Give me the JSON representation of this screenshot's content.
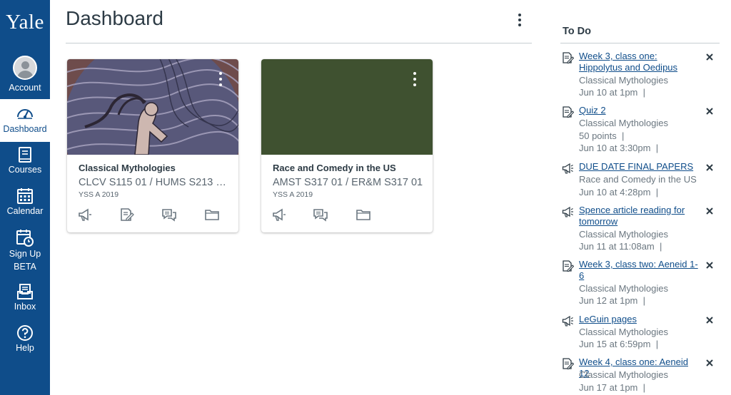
{
  "global_nav": {
    "logo": "Yale",
    "items": [
      {
        "label": "Account",
        "icon": "user-avatar-icon"
      },
      {
        "label": "Dashboard",
        "icon": "dashboard-gauge-icon"
      },
      {
        "label": "Courses",
        "icon": "courses-book-icon"
      },
      {
        "label": "Calendar",
        "icon": "calendar-icon"
      },
      {
        "label": "Sign Up",
        "label2": "BETA",
        "icon": "signup-calendar-clock-icon"
      },
      {
        "label": "Inbox",
        "icon": "inbox-tray-icon"
      },
      {
        "label": "Help",
        "icon": "help-question-icon"
      }
    ],
    "active": "Dashboard",
    "colors": {
      "background": "#0f4d8a",
      "active_background": "#ffffff"
    }
  },
  "dashboard": {
    "title": "Dashboard",
    "cards": [
      {
        "title": "Classical Mythologies",
        "code": "CLCV S115 01 / HUMS S213 01 / ...",
        "term": "YSS A 2019",
        "hero": "image",
        "icons": [
          "announcements-icon",
          "assignments-icon",
          "discussions-icon",
          "files-icon"
        ]
      },
      {
        "title": "Race and Comedy in the US",
        "code": "AMST S317 01 / ER&M S317 01",
        "term": "YSS A 2019",
        "hero": "color",
        "hero_color": "#3f5130",
        "icons": [
          "announcements-icon",
          "discussions-icon",
          "files-icon"
        ]
      }
    ]
  },
  "todo": {
    "title": "To Do",
    "items": [
      {
        "type": "assignment",
        "icon": "assignment-icon",
        "title": "Week 3, class one: Hippolytus and Oedipus",
        "course": "Classical Mythologies",
        "points": "",
        "due": "Jun 10 at 1pm",
        "sep": "|"
      },
      {
        "type": "assignment",
        "icon": "assignment-icon",
        "title": "Quiz 2",
        "course": "Classical Mythologies",
        "points": "50 points",
        "due": "Jun 10 at 3:30pm",
        "sep": "|"
      },
      {
        "type": "announcement",
        "icon": "announcement-megaphone-icon",
        "title": "DUE DATE FINAL PAPERS",
        "course": "Race and Comedy in the US",
        "points": "",
        "due": "Jun 10 at 4:28pm",
        "sep": "|"
      },
      {
        "type": "announcement",
        "icon": "announcement-megaphone-icon",
        "title": "Spence article reading for tomorrow",
        "course": "Classical Mythologies",
        "points": "",
        "due": "Jun 11 at 11:08am",
        "sep": "|"
      },
      {
        "type": "assignment",
        "icon": "assignment-icon",
        "title": "Week 3, class two: Aeneid 1-6",
        "course": "Classical Mythologies",
        "points": "",
        "due": "Jun 12 at 1pm",
        "sep": "|"
      },
      {
        "type": "announcement",
        "icon": "announcement-megaphone-icon",
        "title": "LeGuin pages",
        "course": "Classical Mythologies",
        "points": "",
        "due": "Jun 15 at 6:59pm",
        "sep": "|"
      },
      {
        "type": "assignment",
        "icon": "assignment-icon",
        "title": "Week 4, class one: Aeneid 12",
        "course": "Classical Mythologies",
        "points": "",
        "due": "Jun 17 at 1pm",
        "sep": "|"
      }
    ]
  }
}
